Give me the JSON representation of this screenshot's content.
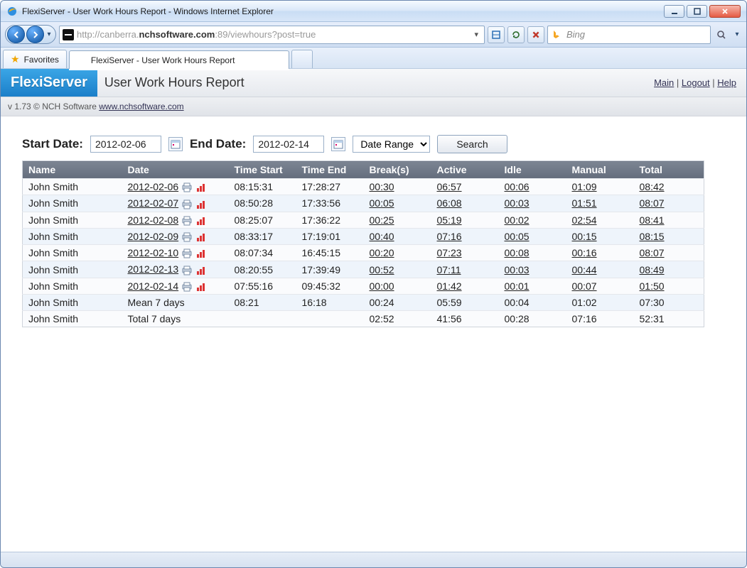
{
  "window_title": "FlexiServer - User Work Hours Report - Windows Internet Explorer",
  "address": {
    "prefix": "http://canberra.",
    "host": "nchsoftware.com",
    "suffix": ":89/viewhours?post=true"
  },
  "search_provider": "Bing",
  "favorites_label": "Favorites",
  "tab_title": "FlexiServer - User Work Hours Report",
  "brand": "FlexiServer",
  "page_title": "User Work Hours Report",
  "links": {
    "main": "Main",
    "logout": "Logout",
    "help": "Help"
  },
  "version_line": "v 1.73 © NCH Software ",
  "version_link": "www.nchsoftware.com",
  "filters": {
    "start_label": "Start Date:",
    "start_value": "2012-02-06",
    "end_label": "End Date:",
    "end_value": "2012-02-14",
    "range_label": "Date Range",
    "search_label": "Search"
  },
  "columns": {
    "name": "Name",
    "date": "Date",
    "tstart": "Time Start",
    "tend": "Time End",
    "break": "Break(s)",
    "active": "Active",
    "idle": "Idle",
    "manual": "Manual",
    "total": "Total"
  },
  "rows": [
    {
      "name": "John Smith",
      "date": "2012-02-06",
      "tstart": "08:15:31",
      "tend": "17:28:27",
      "break": "00:30",
      "active": "06:57",
      "idle": "00:06",
      "manual": "01:09",
      "total": "08:42",
      "link": true
    },
    {
      "name": "John Smith",
      "date": "2012-02-07",
      "tstart": "08:50:28",
      "tend": "17:33:56",
      "break": "00:05",
      "active": "06:08",
      "idle": "00:03",
      "manual": "01:51",
      "total": "08:07",
      "link": true
    },
    {
      "name": "John Smith",
      "date": "2012-02-08",
      "tstart": "08:25:07",
      "tend": "17:36:22",
      "break": "00:25",
      "active": "05:19",
      "idle": "00:02",
      "manual": "02:54",
      "total": "08:41",
      "link": true
    },
    {
      "name": "John Smith",
      "date": "2012-02-09",
      "tstart": "08:33:17",
      "tend": "17:19:01",
      "break": "00:40",
      "active": "07:16",
      "idle": "00:05",
      "manual": "00:15",
      "total": "08:15",
      "link": true
    },
    {
      "name": "John Smith",
      "date": "2012-02-10",
      "tstart": "08:07:34",
      "tend": "16:45:15",
      "break": "00:20",
      "active": "07:23",
      "idle": "00:08",
      "manual": "00:16",
      "total": "08:07",
      "link": true
    },
    {
      "name": "John Smith",
      "date": "2012-02-13",
      "tstart": "08:20:55",
      "tend": "17:39:49",
      "break": "00:52",
      "active": "07:11",
      "idle": "00:03",
      "manual": "00:44",
      "total": "08:49",
      "link": true
    },
    {
      "name": "John Smith",
      "date": "2012-02-14",
      "tstart": "07:55:16",
      "tend": "09:45:32",
      "break": "00:00",
      "active": "01:42",
      "idle": "00:01",
      "manual": "00:07",
      "total": "01:50",
      "link": true
    },
    {
      "name": "John Smith",
      "date": "Mean 7 days",
      "tstart": "08:21",
      "tend": "16:18",
      "break": "00:24",
      "active": "05:59",
      "idle": "00:04",
      "manual": "01:02",
      "total": "07:30",
      "link": false
    },
    {
      "name": "John Smith",
      "date": "Total 7 days",
      "tstart": "",
      "tend": "",
      "break": "02:52",
      "active": "41:56",
      "idle": "00:28",
      "manual": "07:16",
      "total": "52:31",
      "link": false
    }
  ]
}
